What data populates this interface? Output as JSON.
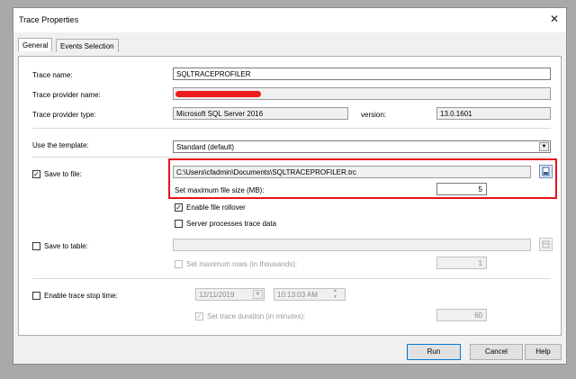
{
  "window": {
    "title": "Trace Properties",
    "close_glyph": "✕"
  },
  "tabs": [
    {
      "label": "General",
      "active": true
    },
    {
      "label": "Events Selection",
      "active": false
    }
  ],
  "general": {
    "trace_name_label": "Trace name:",
    "trace_name_value": "SQLTRACEPROFILER",
    "provider_name_label": "Trace provider name:",
    "provider_type_label": "Trace provider type:",
    "provider_type_value": "Microsoft SQL Server 2016",
    "version_label": "version:",
    "version_value": "13.0.1601",
    "template_label": "Use the template:",
    "template_value": "Standard (default)"
  },
  "save_to_file": {
    "label": "Save to file:",
    "checked": true,
    "path": "C:\\Users\\cfadmin\\Documents\\SQLTRACEPROFILER.trc",
    "max_size_label": "Set maximum file size (MB):",
    "max_size_value": "5",
    "rollover_label": "Enable file rollover",
    "rollover_checked": true,
    "server_processes_label": "Server processes trace data",
    "server_processes_checked": false,
    "highlight_color": "#e5141b"
  },
  "save_to_table": {
    "label": "Save to table:",
    "checked": false,
    "max_rows_label": "Set maximum rows (in thousands):",
    "max_rows_value": "1"
  },
  "stop_time": {
    "label": "Enable trace stop time:",
    "checked": false,
    "date": "12/11/2019",
    "time": "10:13:03 AM",
    "duration_label": "Set trace duration (in minutes):",
    "duration_value": "60"
  },
  "buttons": {
    "run": "Run",
    "cancel": "Cancel",
    "help": "Help"
  },
  "glyphs": {
    "check": "✓",
    "dropdown": "▼",
    "spin_up": "▲",
    "spin_down": "▼"
  },
  "colors": {
    "redaction": "#ee1c1c",
    "default_button_border": "#0078d7"
  }
}
